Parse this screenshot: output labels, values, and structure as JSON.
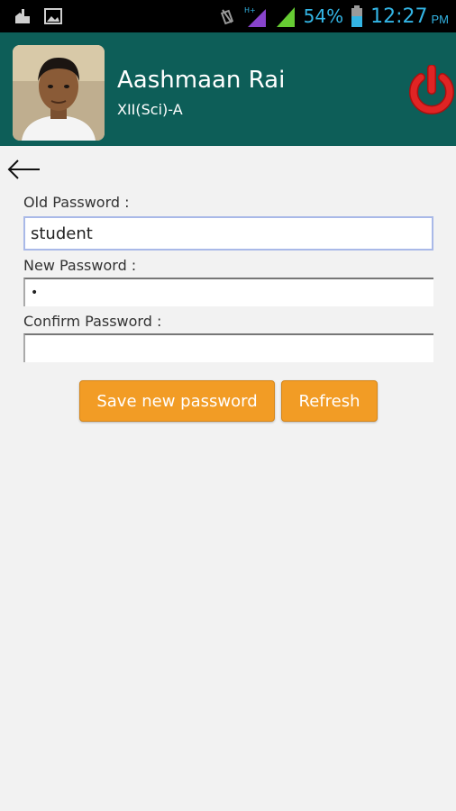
{
  "status_bar": {
    "battery_percent": "54%",
    "time": "12:27",
    "ampm": "PM",
    "network_label": "H+"
  },
  "header": {
    "user_name": "Aashmaan Rai",
    "user_class": "XII(Sci)-A"
  },
  "form": {
    "old_password_label": "Old Password :",
    "old_password_value": "student",
    "new_password_label": "New Password :",
    "new_password_value": "•",
    "confirm_password_label": "Confirm Password :",
    "confirm_password_value": ""
  },
  "buttons": {
    "save_label": "Save new password",
    "refresh_label": "Refresh"
  },
  "colors": {
    "header_bg": "#0d5e58",
    "button_bg": "#f29c25",
    "power_icon": "#d41c1c",
    "status_accent": "#33b5e5"
  }
}
